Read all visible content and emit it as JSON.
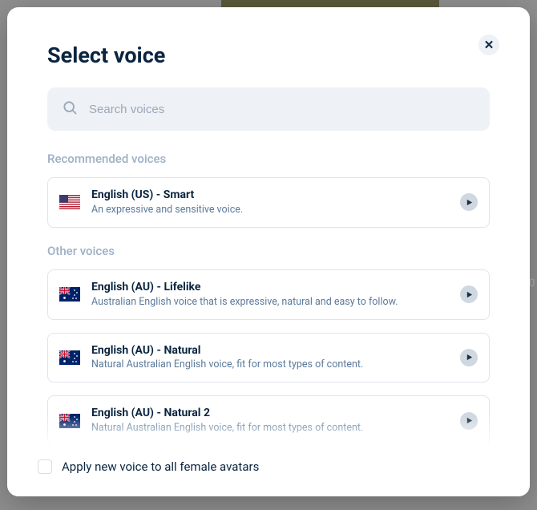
{
  "modal": {
    "title": "Select voice",
    "search_placeholder": "Search voices"
  },
  "sections": {
    "recommended_label": "Recommended voices",
    "other_label": "Other voices"
  },
  "recommended": [
    {
      "name": "English (US) - Smart",
      "desc": "An expressive and sensitive voice.",
      "flag": "us"
    }
  ],
  "other": [
    {
      "name": "English (AU) - Lifelike",
      "desc": "Australian English voice that is expressive, natural and easy to follow.",
      "flag": "au"
    },
    {
      "name": "English (AU) - Natural",
      "desc": "Natural Australian English voice, fit for most types of content.",
      "flag": "au"
    },
    {
      "name": "English (AU) - Natural 2",
      "desc": "Natural Australian English voice, fit for most types of content.",
      "flag": "au"
    }
  ],
  "footer": {
    "apply_label": "Apply new voice to all female avatars"
  }
}
